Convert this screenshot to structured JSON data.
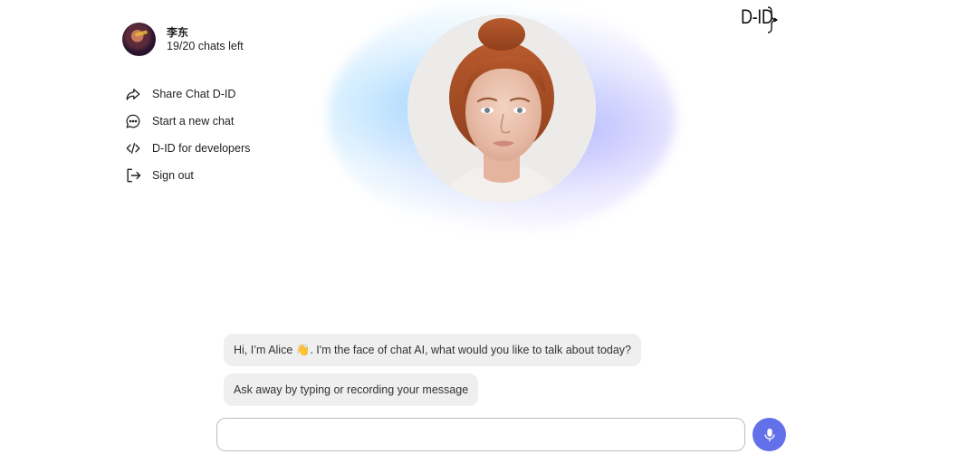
{
  "profile": {
    "name": "李东",
    "chats_left": "19/20 chats left"
  },
  "menu": {
    "items": [
      {
        "label": "Share Chat D-ID",
        "icon": "share-icon"
      },
      {
        "label": "Start a new chat",
        "icon": "chat-bubble-icon"
      },
      {
        "label": "D-ID for developers",
        "icon": "code-icon"
      },
      {
        "label": "Sign out",
        "icon": "sign-out-icon"
      }
    ]
  },
  "logo": {
    "text": "D-ID"
  },
  "messages": [
    {
      "text": "Hi, I’m Alice 👋. I'm the face of chat AI, what would you like to talk about today?"
    },
    {
      "text": "Ask away by typing or recording your message"
    }
  ],
  "composer": {
    "placeholder": "",
    "value": "",
    "mic_icon": "microphone-icon"
  },
  "colors": {
    "accent": "#6270ea",
    "bubble": "#efefef",
    "glow_blue": "#8fd0ff",
    "glow_purple": "#9a90ff"
  }
}
